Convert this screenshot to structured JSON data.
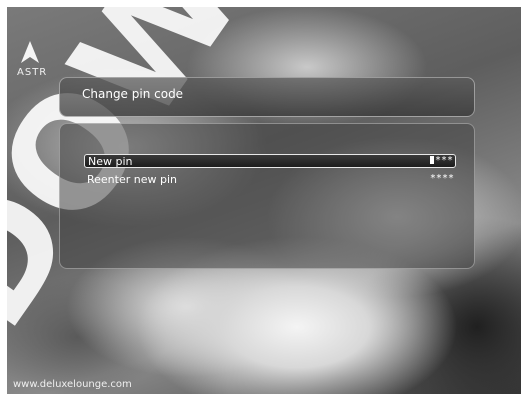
{
  "header": {
    "logo_text": "ASTR"
  },
  "dialog": {
    "title": "Change pin code",
    "fields": [
      {
        "label": "New pin",
        "value": "***",
        "selected": true
      },
      {
        "label": "Reenter new pin",
        "value": "****",
        "selected": false
      }
    ]
  },
  "watermark_text": "DOW",
  "footer": {
    "site": "www.deluxelounge.com"
  }
}
